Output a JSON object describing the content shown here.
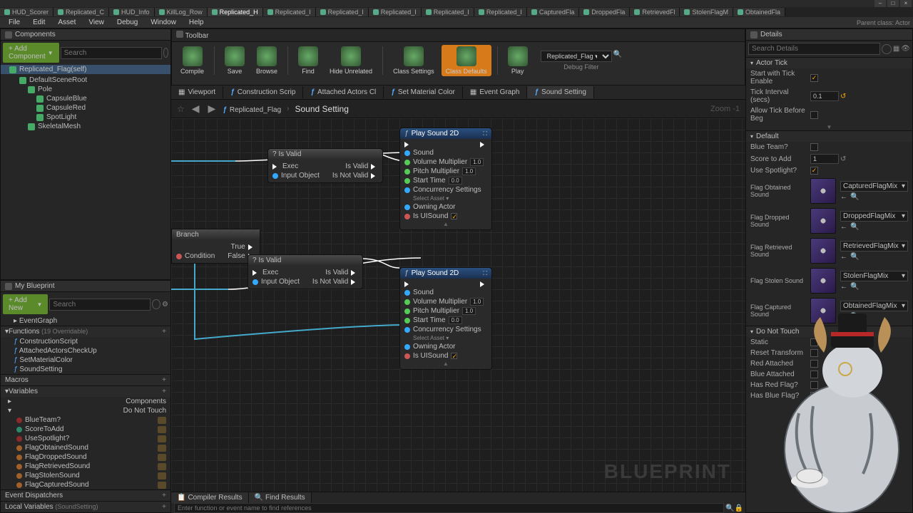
{
  "window": {
    "parent_class": "Parent class: Actor"
  },
  "doc_tabs": [
    {
      "label": "HUD_Scorer"
    },
    {
      "label": "Replicated_C"
    },
    {
      "label": "HUD_Info"
    },
    {
      "label": "KillLog_Row"
    },
    {
      "label": "Replicated_H",
      "active": true
    },
    {
      "label": "Replicated_I"
    },
    {
      "label": "Replicated_I"
    },
    {
      "label": "Replicated_I"
    },
    {
      "label": "Replicated_I"
    },
    {
      "label": "Replicated_I"
    },
    {
      "label": "CapturedFla"
    },
    {
      "label": "DroppedFla"
    },
    {
      "label": "RetrievedFl"
    },
    {
      "label": "StolenFlagM"
    },
    {
      "label": "ObtainedFla"
    }
  ],
  "menubar": [
    "File",
    "Edit",
    "Asset",
    "View",
    "Debug",
    "Window",
    "Help"
  ],
  "components": {
    "title": "Components",
    "add_label": "+ Add Component",
    "search_placeholder": "Search",
    "root_item": "Replicated_Flag(self)",
    "tree": [
      {
        "label": "DefaultSceneRoot",
        "depth": 1
      },
      {
        "label": "Pole",
        "depth": 2
      },
      {
        "label": "CapsuleBlue",
        "depth": 3
      },
      {
        "label": "CapsuleRed",
        "depth": 3
      },
      {
        "label": "SpotLight",
        "depth": 3
      },
      {
        "label": "SkeletalMesh",
        "depth": 2
      }
    ]
  },
  "my_blueprint": {
    "title": "My Blueprint",
    "add_label": "+ Add New",
    "search_placeholder": "Search",
    "graphs_label": "EventGraph",
    "functions_label": "Functions",
    "functions_hint": "(19 Overridable)",
    "functions": [
      "ConstructionScript",
      "AttachedActorsCheckUp",
      "SetMaterialColor",
      "SoundSetting"
    ],
    "macros_label": "Macros",
    "variables_label": "Variables",
    "components_label": "Components",
    "dnt_label": "Do Not Touch",
    "variables": [
      {
        "name": "BlueTeam?",
        "color": "#8a2a2a"
      },
      {
        "name": "ScoreToAdd",
        "color": "#2a8a6a"
      },
      {
        "name": "UseSpotlight?",
        "color": "#8a2a2a"
      },
      {
        "name": "FlagObtainedSound",
        "color": "#a06028"
      },
      {
        "name": "FlagDroppedSound",
        "color": "#a06028"
      },
      {
        "name": "FlagRetrievedSound",
        "color": "#a06028"
      },
      {
        "name": "FlagStolenSound",
        "color": "#a06028"
      },
      {
        "name": "FlagCapturedSound",
        "color": "#a06028"
      }
    ],
    "dispatchers_label": "Event Dispatchers",
    "locals_label": "Local Variables",
    "locals_hint": "(SoundSetting)"
  },
  "toolbar": {
    "title": "Toolbar",
    "buttons": [
      {
        "label": "Compile"
      },
      {
        "label": "Save"
      },
      {
        "label": "Browse"
      },
      {
        "label": "Find"
      },
      {
        "label": "Hide Unrelated"
      },
      {
        "label": "Class Settings"
      },
      {
        "label": "Class Defaults",
        "active": true
      },
      {
        "label": "Play"
      }
    ],
    "debug_selected": "Replicated_Flag ▾",
    "debug_label": "Debug Filter"
  },
  "graph_tabs": [
    {
      "label": "Viewport",
      "func": false
    },
    {
      "label": "Construction Scrip",
      "func": true
    },
    {
      "label": "Attached Actors Cl",
      "func": true
    },
    {
      "label": "Set Material Color",
      "func": true
    },
    {
      "label": "Event Graph",
      "func": false
    },
    {
      "label": "Sound Setting",
      "func": true,
      "active": true
    }
  ],
  "breadcrumb": {
    "root": "Replicated_Flag",
    "leaf": "Sound Setting",
    "zoom": "Zoom -1"
  },
  "nodes": {
    "branch": {
      "title": "Branch",
      "condition": "Condition",
      "true": "True",
      "false": "False"
    },
    "isvalid": {
      "title": "? Is Valid",
      "exec": "Exec",
      "input": "Input Object",
      "valid": "Is Valid",
      "notvalid": "Is Not Valid"
    },
    "playsound": {
      "title": "Play Sound 2D",
      "sound": "Sound",
      "volmult": "Volume Multiplier",
      "volval": "1.0",
      "pitchmult": "Pitch Multiplier",
      "pitchval": "1.0",
      "starttime": "Start Time",
      "startval": "0.0",
      "concurrency": "Concurrency Settings",
      "selectasset": "Select Asset ▾",
      "owning": "Owning Actor",
      "isui": "Is UISound"
    }
  },
  "watermark": "BLUEPRINT",
  "bottom": {
    "compiler": "Compiler Results",
    "find": "Find Results",
    "find_placeholder": "Enter function or event name to find references"
  },
  "details": {
    "title": "Details",
    "search_placeholder": "Search Details",
    "actor_tick": {
      "title": "Actor Tick",
      "start": "Start with Tick Enable",
      "interval": "Tick Interval (secs)",
      "interval_val": "0.1",
      "allow": "Allow Tick Before Beg"
    },
    "default": {
      "title": "Default",
      "blue": "Blue Team?",
      "score": "Score to Add",
      "score_val": "1",
      "spot": "Use Spotlight?"
    },
    "sounds": [
      {
        "label": "Flag Obtained Sound",
        "asset": "CapturedFlagMix"
      },
      {
        "label": "Flag Dropped Sound",
        "asset": "DroppedFlagMix"
      },
      {
        "label": "Flag Retrieved Sound",
        "asset": "RetrievedFlagMix"
      },
      {
        "label": "Flag Stolen Sound",
        "asset": "StolenFlagMix"
      },
      {
        "label": "Flag Captured Sound",
        "asset": "ObtainedFlagMix"
      }
    ],
    "dnt": {
      "title": "Do Not Touch",
      "rows": [
        "Static",
        "Reset Transform",
        "Red Attached",
        "Blue Attached",
        "Has Red Flag?",
        "Has Blue Flag?"
      ]
    }
  }
}
